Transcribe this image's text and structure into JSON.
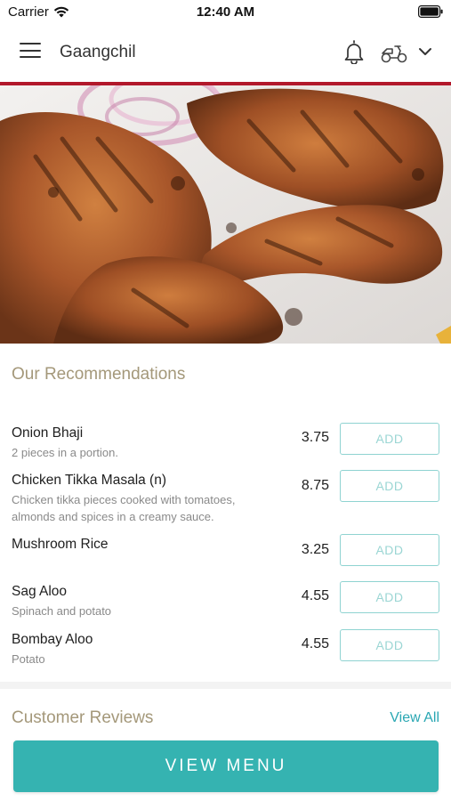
{
  "status_bar": {
    "carrier": "Carrier",
    "time": "12:40 AM"
  },
  "nav": {
    "title": "Gaangchil",
    "icons": [
      "menu-icon",
      "bell-icon",
      "scooter-icon",
      "chevron-down-icon"
    ]
  },
  "colors": {
    "accent_red": "#b2182b",
    "teal": "#35b3b1",
    "section_title": "#a4987a",
    "add_border": "#8fd3d1"
  },
  "recommendations": {
    "title": "Our Recommendations",
    "add_label": "ADD",
    "items": [
      {
        "name": "Onion Bhaji",
        "description": "2 pieces in a portion.",
        "price": "3.75"
      },
      {
        "name": "Chicken Tikka Masala (n)",
        "description": "Chicken tikka pieces cooked with tomatoes, almonds and spices in a creamy sauce.",
        "price": "8.75"
      },
      {
        "name": "Mushroom Rice",
        "description": "",
        "price": "3.25"
      },
      {
        "name": "Sag Aloo",
        "description": "Spinach and potato",
        "price": "4.55"
      },
      {
        "name": "Bombay Aloo",
        "description": "Potato",
        "price": "4.55"
      }
    ]
  },
  "reviews": {
    "title": "Customer Reviews",
    "view_all": "View All"
  },
  "footer": {
    "view_menu": "VIEW MENU"
  }
}
